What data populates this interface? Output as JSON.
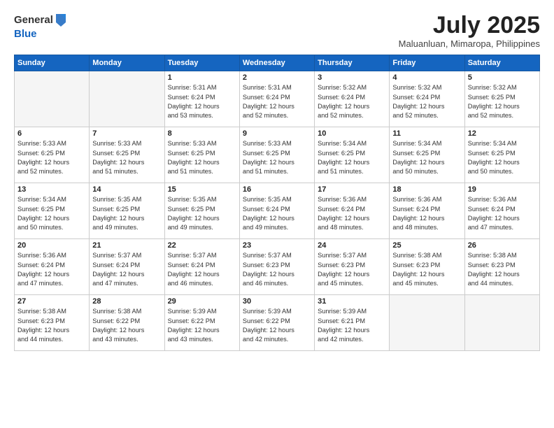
{
  "header": {
    "logo_line1": "General",
    "logo_line2": "Blue",
    "month_title": "July 2025",
    "location": "Maluanluan, Mimaropa, Philippines"
  },
  "weekdays": [
    "Sunday",
    "Monday",
    "Tuesday",
    "Wednesday",
    "Thursday",
    "Friday",
    "Saturday"
  ],
  "weeks": [
    [
      {
        "day": "",
        "info": ""
      },
      {
        "day": "",
        "info": ""
      },
      {
        "day": "1",
        "info": "Sunrise: 5:31 AM\nSunset: 6:24 PM\nDaylight: 12 hours\nand 53 minutes."
      },
      {
        "day": "2",
        "info": "Sunrise: 5:31 AM\nSunset: 6:24 PM\nDaylight: 12 hours\nand 52 minutes."
      },
      {
        "day": "3",
        "info": "Sunrise: 5:32 AM\nSunset: 6:24 PM\nDaylight: 12 hours\nand 52 minutes."
      },
      {
        "day": "4",
        "info": "Sunrise: 5:32 AM\nSunset: 6:24 PM\nDaylight: 12 hours\nand 52 minutes."
      },
      {
        "day": "5",
        "info": "Sunrise: 5:32 AM\nSunset: 6:25 PM\nDaylight: 12 hours\nand 52 minutes."
      }
    ],
    [
      {
        "day": "6",
        "info": "Sunrise: 5:33 AM\nSunset: 6:25 PM\nDaylight: 12 hours\nand 52 minutes."
      },
      {
        "day": "7",
        "info": "Sunrise: 5:33 AM\nSunset: 6:25 PM\nDaylight: 12 hours\nand 51 minutes."
      },
      {
        "day": "8",
        "info": "Sunrise: 5:33 AM\nSunset: 6:25 PM\nDaylight: 12 hours\nand 51 minutes."
      },
      {
        "day": "9",
        "info": "Sunrise: 5:33 AM\nSunset: 6:25 PM\nDaylight: 12 hours\nand 51 minutes."
      },
      {
        "day": "10",
        "info": "Sunrise: 5:34 AM\nSunset: 6:25 PM\nDaylight: 12 hours\nand 51 minutes."
      },
      {
        "day": "11",
        "info": "Sunrise: 5:34 AM\nSunset: 6:25 PM\nDaylight: 12 hours\nand 50 minutes."
      },
      {
        "day": "12",
        "info": "Sunrise: 5:34 AM\nSunset: 6:25 PM\nDaylight: 12 hours\nand 50 minutes."
      }
    ],
    [
      {
        "day": "13",
        "info": "Sunrise: 5:34 AM\nSunset: 6:25 PM\nDaylight: 12 hours\nand 50 minutes."
      },
      {
        "day": "14",
        "info": "Sunrise: 5:35 AM\nSunset: 6:25 PM\nDaylight: 12 hours\nand 49 minutes."
      },
      {
        "day": "15",
        "info": "Sunrise: 5:35 AM\nSunset: 6:25 PM\nDaylight: 12 hours\nand 49 minutes."
      },
      {
        "day": "16",
        "info": "Sunrise: 5:35 AM\nSunset: 6:24 PM\nDaylight: 12 hours\nand 49 minutes."
      },
      {
        "day": "17",
        "info": "Sunrise: 5:36 AM\nSunset: 6:24 PM\nDaylight: 12 hours\nand 48 minutes."
      },
      {
        "day": "18",
        "info": "Sunrise: 5:36 AM\nSunset: 6:24 PM\nDaylight: 12 hours\nand 48 minutes."
      },
      {
        "day": "19",
        "info": "Sunrise: 5:36 AM\nSunset: 6:24 PM\nDaylight: 12 hours\nand 47 minutes."
      }
    ],
    [
      {
        "day": "20",
        "info": "Sunrise: 5:36 AM\nSunset: 6:24 PM\nDaylight: 12 hours\nand 47 minutes."
      },
      {
        "day": "21",
        "info": "Sunrise: 5:37 AM\nSunset: 6:24 PM\nDaylight: 12 hours\nand 47 minutes."
      },
      {
        "day": "22",
        "info": "Sunrise: 5:37 AM\nSunset: 6:24 PM\nDaylight: 12 hours\nand 46 minutes."
      },
      {
        "day": "23",
        "info": "Sunrise: 5:37 AM\nSunset: 6:23 PM\nDaylight: 12 hours\nand 46 minutes."
      },
      {
        "day": "24",
        "info": "Sunrise: 5:37 AM\nSunset: 6:23 PM\nDaylight: 12 hours\nand 45 minutes."
      },
      {
        "day": "25",
        "info": "Sunrise: 5:38 AM\nSunset: 6:23 PM\nDaylight: 12 hours\nand 45 minutes."
      },
      {
        "day": "26",
        "info": "Sunrise: 5:38 AM\nSunset: 6:23 PM\nDaylight: 12 hours\nand 44 minutes."
      }
    ],
    [
      {
        "day": "27",
        "info": "Sunrise: 5:38 AM\nSunset: 6:23 PM\nDaylight: 12 hours\nand 44 minutes."
      },
      {
        "day": "28",
        "info": "Sunrise: 5:38 AM\nSunset: 6:22 PM\nDaylight: 12 hours\nand 43 minutes."
      },
      {
        "day": "29",
        "info": "Sunrise: 5:39 AM\nSunset: 6:22 PM\nDaylight: 12 hours\nand 43 minutes."
      },
      {
        "day": "30",
        "info": "Sunrise: 5:39 AM\nSunset: 6:22 PM\nDaylight: 12 hours\nand 42 minutes."
      },
      {
        "day": "31",
        "info": "Sunrise: 5:39 AM\nSunset: 6:21 PM\nDaylight: 12 hours\nand 42 minutes."
      },
      {
        "day": "",
        "info": ""
      },
      {
        "day": "",
        "info": ""
      }
    ]
  ]
}
